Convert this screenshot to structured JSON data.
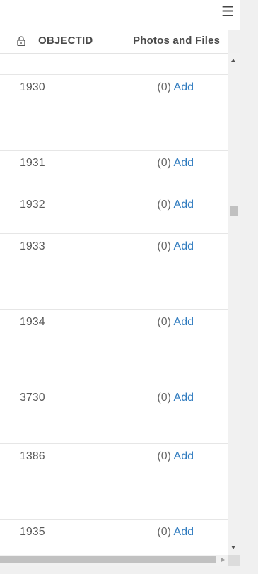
{
  "toolbar": {
    "menu_icon": "hamburger-menu-icon"
  },
  "table": {
    "columns": {
      "objectid": {
        "label": "OBJECTID",
        "icon": "lock-icon"
      },
      "photos": {
        "label": "Photos and Files"
      }
    },
    "rows": [
      {
        "objectid": "",
        "count": "",
        "add": ""
      },
      {
        "objectid": "1930",
        "count": "(0)",
        "add": "Add"
      },
      {
        "objectid": "1931",
        "count": "(0)",
        "add": "Add"
      },
      {
        "objectid": "1932",
        "count": "(0)",
        "add": "Add"
      },
      {
        "objectid": "1933",
        "count": "(0)",
        "add": "Add"
      },
      {
        "objectid": "1934",
        "count": "(0)",
        "add": "Add"
      },
      {
        "objectid": "3730",
        "count": "(0)",
        "add": "Add"
      },
      {
        "objectid": "1386",
        "count": "(0)",
        "add": "Add"
      },
      {
        "objectid": "1935",
        "count": "(0)",
        "add": "Add"
      }
    ]
  },
  "colors": {
    "link": "#2f7bbf",
    "text": "#5a5a5a",
    "grid": "#e6e6e6"
  }
}
